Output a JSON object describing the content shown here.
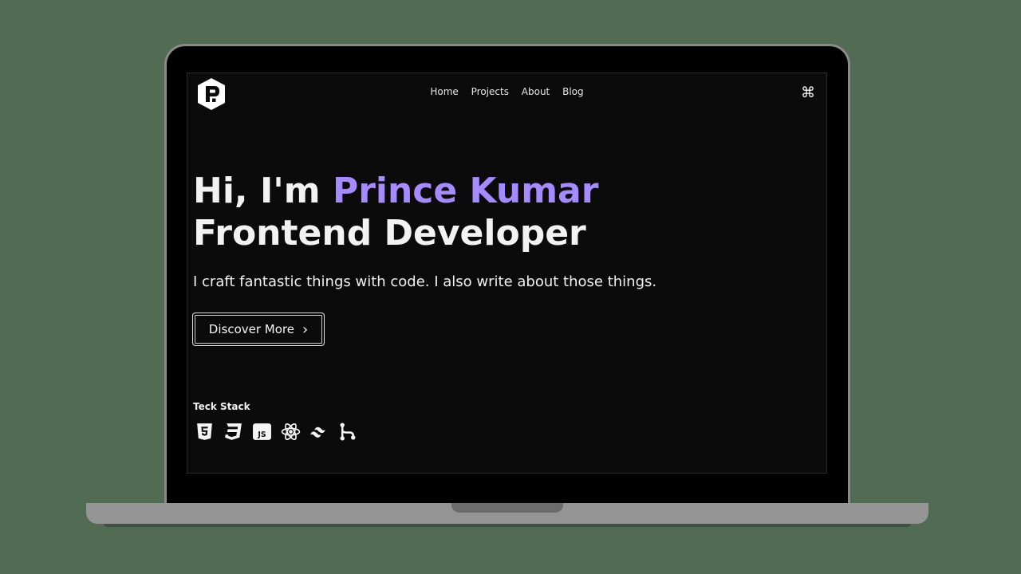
{
  "nav": {
    "items": [
      {
        "label": "Home"
      },
      {
        "label": "Projects"
      },
      {
        "label": "About"
      },
      {
        "label": "Blog"
      }
    ],
    "command_symbol": "⌘"
  },
  "hero": {
    "greeting": "Hi, I'm ",
    "name": "Prince Kumar",
    "role": "Frontend Developer",
    "tagline": "I craft fantastic things with code. I also write about those things.",
    "cta_label": "Discover More",
    "cta_chevron": "›"
  },
  "stack": {
    "label": "Teck Stack",
    "icons": [
      "html5-icon",
      "css3-icon",
      "javascript-icon",
      "react-icon",
      "tailwind-icon",
      "git-icon"
    ],
    "js_text": "JS"
  },
  "colors": {
    "background": "#526b53",
    "screen": "#0b0b0b",
    "accent": "#a58bff",
    "text": "#f2f2f2"
  }
}
